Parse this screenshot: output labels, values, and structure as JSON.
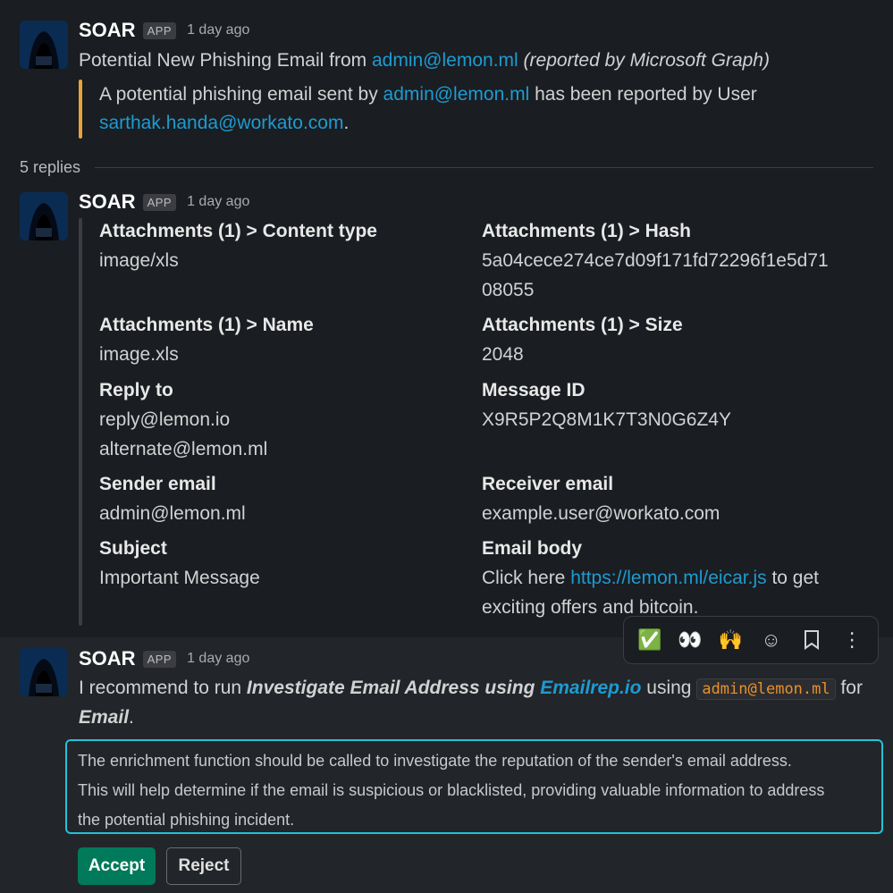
{
  "messages": [
    {
      "sender": "SOAR",
      "badge": "APP",
      "time": "1 day ago",
      "title_prefix": "Potential New Phishing Email from ",
      "title_link": "admin@lemon.ml",
      "title_suffix": "(reported by Microsoft Graph)",
      "quote_prefix": "A potential phishing email sent by ",
      "quote_link1": "admin@lemon.ml",
      "quote_middle": " has been reported by User",
      "quote_link2": "sarthak.handa@workato.com",
      "quote_end": ".",
      "quote_color": "#e8a33d"
    }
  ],
  "thread": {
    "replies": "5 replies"
  },
  "reply1": {
    "sender": "SOAR",
    "badge": "APP",
    "time": "1 day ago",
    "fields": {
      "content_type": {
        "label": "Attachments (1) > Content type",
        "value": "image/xls"
      },
      "hash": {
        "label": "Attachments (1) > Hash",
        "value_line1": "5a04cece274ce7d09f171fd72296f1e5d71",
        "value_line2": "08055"
      },
      "name": {
        "label": "Attachments (1) > Name",
        "value": "image.xls"
      },
      "size": {
        "label": "Attachments (1) > Size",
        "value": "2048"
      },
      "reply_to": {
        "label": "Reply to",
        "value1": "reply@lemon.io",
        "value2": "alternate@lemon.ml"
      },
      "message_id": {
        "label": "Message ID",
        "value": "X9R5P2Q8M1K7T3N0G6Z4Y"
      },
      "sender_email": {
        "label": "Sender email",
        "value": "admin@lemon.ml"
      },
      "receiver_email": {
        "label": "Receiver email",
        "value": "example.user@workato.com"
      },
      "subject": {
        "label": "Subject",
        "value": "Important Message"
      },
      "email_body": {
        "label": "Email body",
        "prefix": "Click here ",
        "link": "https://lemon.ml/eicar.js",
        "suffix": " to get",
        "line2": "exciting offers and bitcoin."
      }
    }
  },
  "toolbar": {
    "items": [
      {
        "name": "check-emoji",
        "glyph": "✅"
      },
      {
        "name": "eyes-emoji",
        "glyph": "👀"
      },
      {
        "name": "raised-hands-emoji",
        "glyph": "🙌"
      },
      {
        "name": "add-reaction-icon",
        "glyph": "☺"
      },
      {
        "name": "bookmark-icon",
        "glyph": "🔖"
      },
      {
        "name": "more-actions-icon",
        "glyph": "⋮"
      }
    ]
  },
  "reply2": {
    "sender": "SOAR",
    "badge": "APP",
    "time": "1 day ago",
    "text_prefix": "I recommend to run ",
    "action_name": "Investigate Email Address using ",
    "action_link": "Emailrep.io",
    "text_using": " using ",
    "code_value": "admin@lemon.ml",
    "text_for": " for",
    "target": "Email",
    "target_end": ".",
    "reasoning_line1": "The enrichment function should be called to investigate the reputation of the sender's email address.",
    "reasoning_line2": "This will help determine if the email is suspicious or blacklisted, providing valuable information to address",
    "reasoning_line3": "the potential phishing incident.",
    "accept_label": "Accept",
    "reject_label": "Reject"
  }
}
